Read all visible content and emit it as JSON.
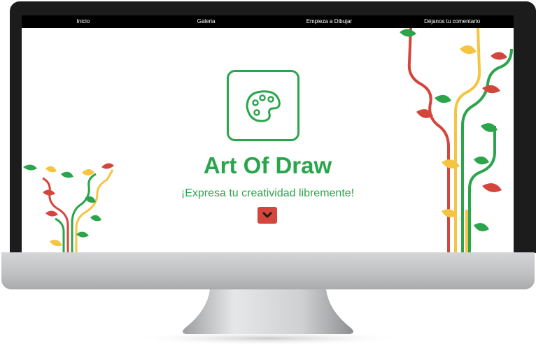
{
  "nav": {
    "items": [
      "Inicio",
      "Galeria",
      "Empieza a Dibujar",
      "Déjanos tu comentario"
    ]
  },
  "hero": {
    "title": "Art Of Draw",
    "tagline": "¡Expresa tu creatividad libremente!"
  },
  "icons": {
    "logo": "palette-icon",
    "scroll": "chevron-down-icon"
  },
  "colors": {
    "brand_green": "#2aa54c",
    "accent_red": "#d4453c",
    "accent_yellow": "#f5c542",
    "navbar_bg": "#000000",
    "bezel": "#1c1c1c",
    "chin": "#c4c5c7"
  }
}
